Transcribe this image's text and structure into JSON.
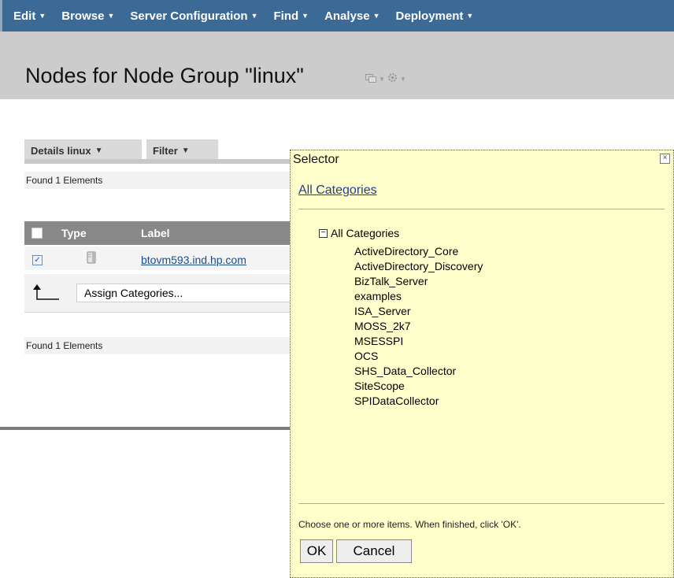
{
  "menu": {
    "items": [
      {
        "label": "Edit"
      },
      {
        "label": "Browse"
      },
      {
        "label": "Server Configuration"
      },
      {
        "label": "Find"
      },
      {
        "label": "Analyse"
      },
      {
        "label": "Deployment"
      }
    ]
  },
  "header": {
    "title": "Nodes for Node Group \"linux\"",
    "icons": [
      "window-icon",
      "caret-down-icon",
      "gear-icon",
      "caret-down-icon"
    ]
  },
  "tabs": [
    {
      "label": "Details linux"
    },
    {
      "label": "Filter"
    }
  ],
  "results": {
    "found_top": "Found 1 Elements",
    "found_bottom": "Found 1 Elements"
  },
  "table": {
    "columns": {
      "type": "Type",
      "label": "Label"
    },
    "rows": [
      {
        "checked": true,
        "icon": "server-icon",
        "label": "btovm593.ind.hp.com"
      }
    ],
    "assign_label": "Assign Categories..."
  },
  "selector": {
    "title": "Selector",
    "breadcrumb": "All Categories",
    "root_label": "All Categories",
    "categories": [
      "ActiveDirectory_Core",
      "ActiveDirectory_Discovery",
      "BizTalk_Server",
      "examples",
      "ISA_Server",
      "MOSS_2k7",
      "MSESSPI",
      "OCS",
      "SHS_Data_Collector",
      "SiteScope",
      "SPIDataCollector"
    ],
    "hint": "Choose one or more items. When finished, click 'OK'.",
    "ok_label": "OK",
    "cancel_label": "Cancel"
  },
  "colors": {
    "menubar": "#3c6a96",
    "titleband": "#cccccc",
    "selector_bg": "#ffffcc",
    "table_header": "#888888"
  }
}
